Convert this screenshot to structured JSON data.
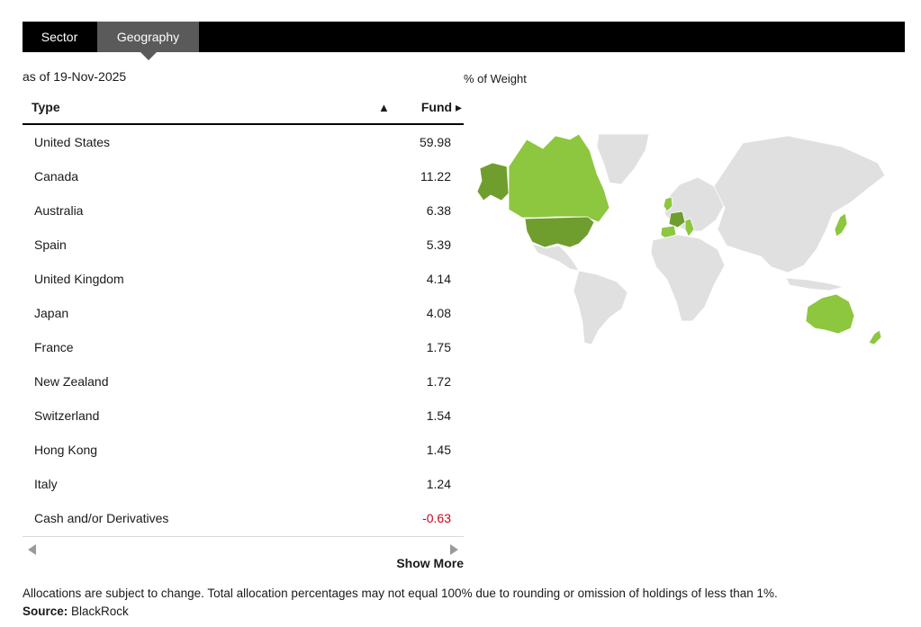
{
  "tabs": {
    "sector": "Sector",
    "geography": "Geography"
  },
  "as_of": "as of 19-Nov-2025",
  "weight_label": "% of Weight",
  "table": {
    "col_type": "Type",
    "sort_icon": "▲",
    "col_fund": "Fund ▸",
    "rows": [
      {
        "name": "United States",
        "value": "59.98"
      },
      {
        "name": "Canada",
        "value": "11.22"
      },
      {
        "name": "Australia",
        "value": "6.38"
      },
      {
        "name": "Spain",
        "value": "5.39"
      },
      {
        "name": "United Kingdom",
        "value": "4.14"
      },
      {
        "name": "Japan",
        "value": "4.08"
      },
      {
        "name": "France",
        "value": "1.75"
      },
      {
        "name": "New Zealand",
        "value": "1.72"
      },
      {
        "name": "Switzerland",
        "value": "1.54"
      },
      {
        "name": "Hong Kong",
        "value": "1.45"
      },
      {
        "name": "Italy",
        "value": "1.24"
      },
      {
        "name": "Cash and/or Derivatives",
        "value": "-0.63"
      }
    ]
  },
  "show_more": "Show More",
  "footnote": "Allocations are subject to change. Total allocation percentages may not equal 100% due to rounding or omission of holdings of less than 1%.",
  "source_label": "Source:",
  "source_value": "BlackRock",
  "colors": {
    "dark_green": "#6f9e2e",
    "light_green": "#8dc63f",
    "grey_land": "#e0e0e0",
    "negative": "#d0021b"
  }
}
